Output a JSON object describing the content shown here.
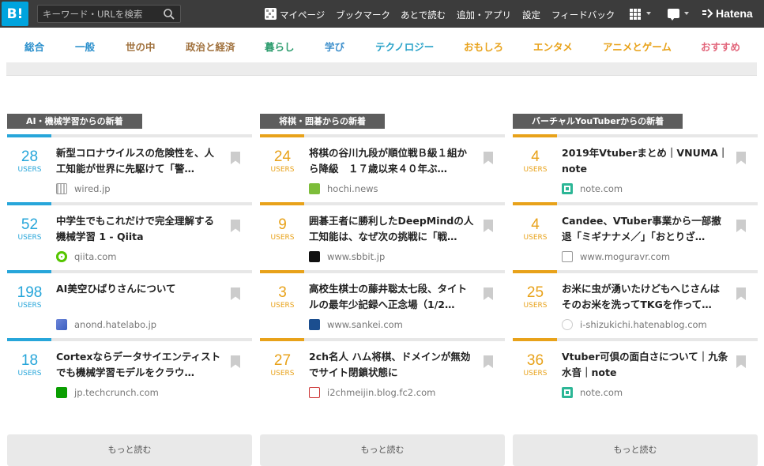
{
  "topbar": {
    "logo": "B!",
    "search_placeholder": "キーワード・URLを検索",
    "links": [
      "マイページ",
      "ブックマーク",
      "あとで読む",
      "追加・アプリ",
      "設定",
      "フィードバック"
    ],
    "brand": "Hatena"
  },
  "categories": [
    {
      "label": "総合",
      "color": "#2a8fcc"
    },
    {
      "label": "一般",
      "color": "#2a8fcc"
    },
    {
      "label": "世の中",
      "color": "#a0713d"
    },
    {
      "label": "政治と経済",
      "color": "#a0713d"
    },
    {
      "label": "暮らし",
      "color": "#2d9c6e"
    },
    {
      "label": "学び",
      "color": "#3d8fcc"
    },
    {
      "label": "テクノロジー",
      "color": "#2aa3c9"
    },
    {
      "label": "おもしろ",
      "color": "#e8a21a"
    },
    {
      "label": "エンタメ",
      "color": "#e8a21a"
    },
    {
      "label": "アニメとゲーム",
      "color": "#e8a21a"
    },
    {
      "label": "おすすめ",
      "color": "#e2667b"
    }
  ],
  "columns": [
    {
      "heading": "AI・機械学習からの新着",
      "accent": "#27a6da",
      "more": "もっと読む",
      "entries": [
        {
          "count": "28",
          "users": "USERS",
          "title": "新型コロナウイルスの危険性を、人工知能が世界に先駆けて「警…",
          "domain": "wired.jp",
          "favicon": "wired-favicon"
        },
        {
          "count": "52",
          "users": "USERS",
          "title": "中学生でもこれだけで完全理解する機械学習 1 - Qiita",
          "domain": "qiita.com",
          "favicon": "qiita-favicon"
        },
        {
          "count": "198",
          "users": "USERS",
          "title": "AI美空ひばりさんについて",
          "domain": "anond.hatelabo.jp",
          "favicon": "hatelabo-favicon"
        },
        {
          "count": "18",
          "users": "USERS",
          "title": "Cortexならデータサイエンティストでも機械学習モデルをクラウ…",
          "domain": "jp.techcrunch.com",
          "favicon": "techcrunch-favicon"
        }
      ]
    },
    {
      "heading": "将棋・囲碁からの新着",
      "accent": "#e8a21a",
      "more": "もっと読む",
      "entries": [
        {
          "count": "24",
          "users": "USERS",
          "title": "将棋の谷川九段が順位戦Ｂ級１組から降級　１７歳以来４０年ぶ…",
          "domain": "hochi.news",
          "favicon": "hochi-favicon"
        },
        {
          "count": "9",
          "users": "USERS",
          "title": "囲碁王者に勝利したDeepMindの人工知能は、なぜ次の挑戦に「戦…",
          "domain": "www.sbbit.jp",
          "favicon": "sbbit-favicon"
        },
        {
          "count": "3",
          "users": "USERS",
          "title": "高校生棋士の藤井聡太七段、タイトルの最年少記録へ正念場（1/2…",
          "domain": "www.sankei.com",
          "favicon": "sankei-favicon"
        },
        {
          "count": "27",
          "users": "USERS",
          "title": "2ch名人 ハム将棋、ドメインが無効でサイト閉鎖状態に",
          "domain": "i2chmeijin.blog.fc2.com",
          "favicon": "fc2-favicon"
        }
      ]
    },
    {
      "heading": "バーチャルYouTuberからの新着",
      "accent": "#e8a21a",
      "more": "もっと読む",
      "entries": [
        {
          "count": "4",
          "users": "USERS",
          "title": "2019年Vtuberまとめ｜VNUMA｜note",
          "domain": "note.com",
          "favicon": "note-favicon"
        },
        {
          "count": "4",
          "users": "USERS",
          "title": "Candee、VTuber事業から一部撤退「ミギナナメ／」「おとりざ…",
          "domain": "www.moguravr.com",
          "favicon": "page-favicon"
        },
        {
          "count": "25",
          "users": "USERS",
          "title": "お米に虫が湧いたけどもへじさんはそのお米を洗ってTKGを作って…",
          "domain": "i-shizukichi.hatenablog.com",
          "favicon": "hatenablog-favicon"
        },
        {
          "count": "36",
          "users": "USERS",
          "title": "Vtuber可倶の面白さについて｜九条水音｜note",
          "domain": "note.com",
          "favicon": "note-favicon"
        }
      ]
    }
  ]
}
